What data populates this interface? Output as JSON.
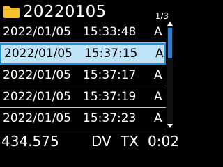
{
  "header": {
    "folder_name": "20220105",
    "page_indicator": "1/3",
    "folder_icon": "folder-icon",
    "folder_color": "#f5c02a"
  },
  "list": {
    "rows": [
      {
        "date": "2022/01/05",
        "time": "15:33:48",
        "flag": "A",
        "selected": false
      },
      {
        "date": "2022/01/05",
        "time": "15:37:15",
        "flag": "A",
        "selected": true
      },
      {
        "date": "2022/01/05",
        "time": "15:37:17",
        "flag": "A",
        "selected": false
      },
      {
        "date": "2022/01/05",
        "time": "15:37:19",
        "flag": "A",
        "selected": false
      },
      {
        "date": "2022/01/05",
        "time": "15:37:23",
        "flag": "A",
        "selected": false
      }
    ],
    "selected_bg": "#bfe3f7",
    "selected_border": "#1e8fd4"
  },
  "scrollbar": {
    "thumb_color": "#2a7fd1"
  },
  "status": {
    "frequency": "434.575",
    "mode": "DV",
    "tx": "TX",
    "elapsed": "0:02"
  }
}
